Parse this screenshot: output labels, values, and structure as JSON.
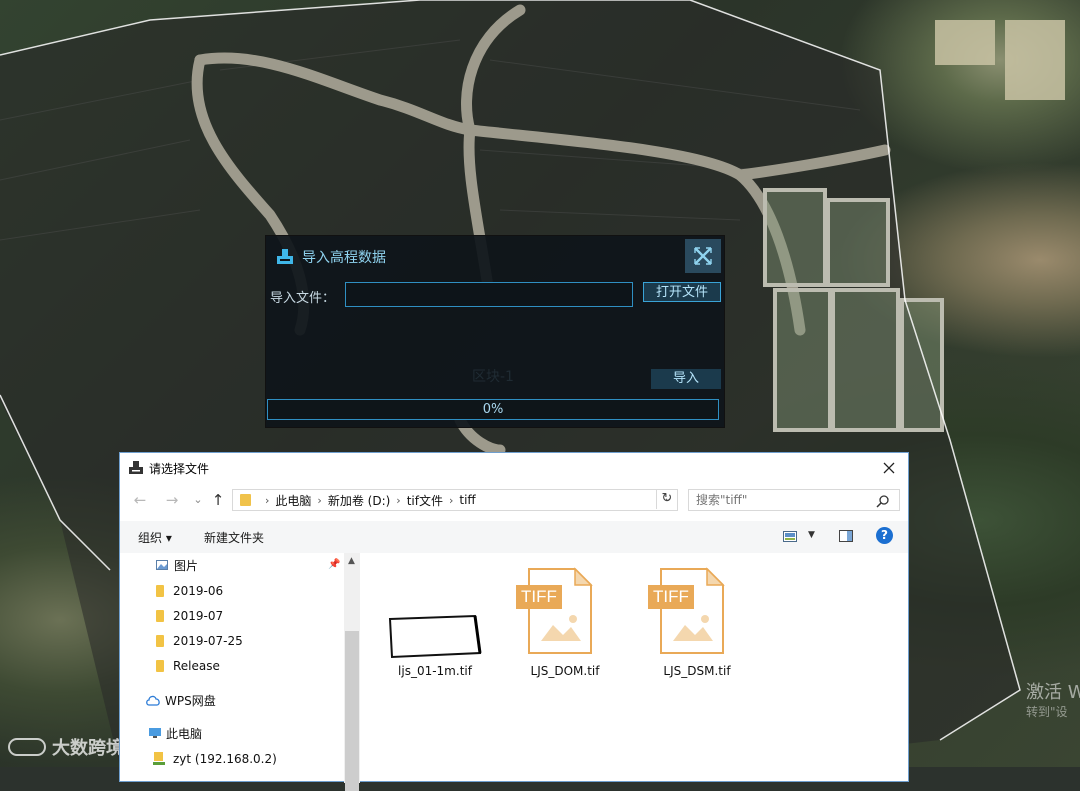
{
  "map": {
    "activate_watermark": "激活 W",
    "activate_watermark_sub": "转到\"设",
    "logo_text": "大数跨境"
  },
  "elevation_dialog": {
    "title": "导入高程数据",
    "file_label": "导入文件：",
    "file_value": "",
    "open_button": "打开文件",
    "block_label": "区块-1",
    "import_button": "导入",
    "progress_text": "0%",
    "progress": 0,
    "colors": {
      "accent": "#2f8fc2",
      "title": "#8fd3ef",
      "panel": "#0e141a"
    }
  },
  "file_dialog": {
    "title": "请选择文件",
    "nav": {
      "back": "←",
      "forward": "→",
      "recent": "⌄",
      "up": "↑"
    },
    "breadcrumb": [
      "此电脑",
      "新加卷 (D:)",
      "tif文件",
      "tiff"
    ],
    "search_placeholder": "搜索\"tiff\"",
    "toolbar": {
      "organize": "组织 ▾",
      "new_folder": "新建文件夹"
    },
    "sidebar": [
      {
        "label": "图片",
        "icon": "pictures-icon",
        "pinned": true
      },
      {
        "label": "2019-06",
        "icon": "folder-icon"
      },
      {
        "label": "2019-07",
        "icon": "folder-icon"
      },
      {
        "label": "2019-07-25",
        "icon": "folder-icon"
      },
      {
        "label": "Release",
        "icon": "folder-icon"
      },
      {
        "label": "WPS网盘",
        "icon": "cloud-icon"
      },
      {
        "label": "此电脑",
        "icon": "computer-icon"
      },
      {
        "label": "zyt (192.168.0.2)",
        "icon": "network-drive-icon"
      }
    ],
    "files": [
      {
        "name": "ljs_01-1m.tif",
        "kind": "thumbnail"
      },
      {
        "name": "LJS_DOM.tif",
        "kind": "tiff",
        "badge": "TIFF"
      },
      {
        "name": "LJS_DSM.tif",
        "kind": "tiff",
        "badge": "TIFF"
      }
    ],
    "colors": {
      "tiff_orange": "#e9a957",
      "help_blue": "#1b6fd1"
    }
  }
}
